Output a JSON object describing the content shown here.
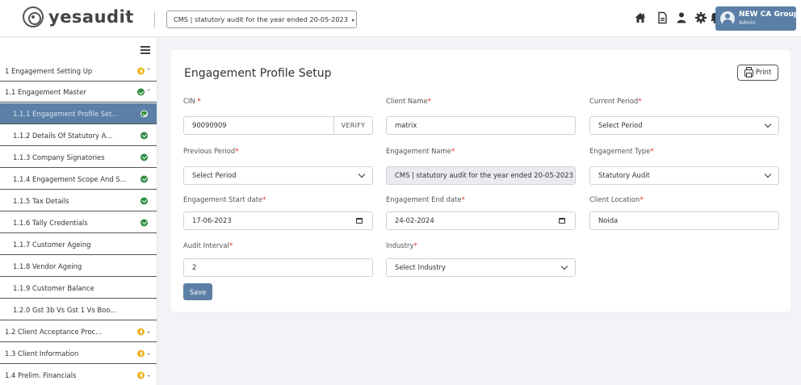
{
  "header": {
    "logo_text": "yesaudit",
    "engagement_select": "CMS | statutory audit for the year ended 20-05-2023",
    "icons": [
      "home-icon",
      "document-icon",
      "user-icon",
      "gear-icon",
      "bell-icon"
    ],
    "user": {
      "name": "NEW CA Group",
      "role": "Admin"
    }
  },
  "sidebar": {
    "items": [
      {
        "label": "1  Engagement Setting Up",
        "level": 1,
        "badge": "yellow",
        "chevron": "up"
      },
      {
        "label": "1.1  Engagement Master",
        "level": 2,
        "badge": "green",
        "chevron": "up"
      },
      {
        "label": "1.1.1  Engagement Profile Set...",
        "level": 3,
        "badge": "green",
        "active": true
      },
      {
        "label": "1.1.2  Details Of Statutory A...",
        "level": 3,
        "badge": "green"
      },
      {
        "label": "1.1.3  Company Signatories",
        "level": 3,
        "badge": "green"
      },
      {
        "label": "1.1.4  Engagement Scope And S...",
        "level": 3,
        "badge": "green"
      },
      {
        "label": "1.1.5  Tax Details",
        "level": 3,
        "badge": "green"
      },
      {
        "label": "1.1.6  Tally Credentials",
        "level": 3,
        "badge": "green"
      },
      {
        "label": "1.1.7  Customer Ageing",
        "level": 3
      },
      {
        "label": "1.1.8  Vendor Ageing",
        "level": 3
      },
      {
        "label": "1.1.9  Customer Balance",
        "level": 3
      },
      {
        "label": "1.2.0  Gst 3b Vs Gst 1 Vs Boo...",
        "level": 3
      },
      {
        "label": "1.2  Client Acceptance Proc...",
        "level": 2,
        "badge": "yellow",
        "chevron": "down"
      },
      {
        "label": "1.3  Client Information",
        "level": 2,
        "badge": "yellow",
        "chevron": "down"
      },
      {
        "label": "1.4  Prelim. Financials",
        "level": 2,
        "badge": "yellow",
        "chevron": "down"
      }
    ]
  },
  "main": {
    "title": "Engagement Profile Setup",
    "print_label": "Print",
    "save_label": "Save",
    "verify_label": "VERIFY",
    "fields": {
      "cin": {
        "label": "CIN",
        "value": "90090909"
      },
      "client_name": {
        "label": "Client Name",
        "value": "matrix"
      },
      "current_period": {
        "label": "Current Period",
        "value": "Select Period"
      },
      "previous_period": {
        "label": "Previous Period",
        "value": "Select Period"
      },
      "engagement_name": {
        "label": "Engagement Name",
        "value": "CMS | statutory audit for the year ended 20-05-2023"
      },
      "engagement_type": {
        "label": "Engagement Type",
        "value": "Statutory Audit"
      },
      "start_date": {
        "label": "Engagement Start date",
        "value": "17-06-2023"
      },
      "end_date": {
        "label": "Engagement End date",
        "value": "24-02-2024"
      },
      "client_location": {
        "label": "Client Location",
        "value": "Noida"
      },
      "audit_interval": {
        "label": "Audit Interval",
        "value": "2"
      },
      "industry": {
        "label": "Industry",
        "value": "Select Industry"
      }
    },
    "required_mark": "*"
  },
  "colors": {
    "accent": "#5b7fa6",
    "success": "#2e8b3e",
    "warning": "#f0b323",
    "required": "#dd3333"
  }
}
